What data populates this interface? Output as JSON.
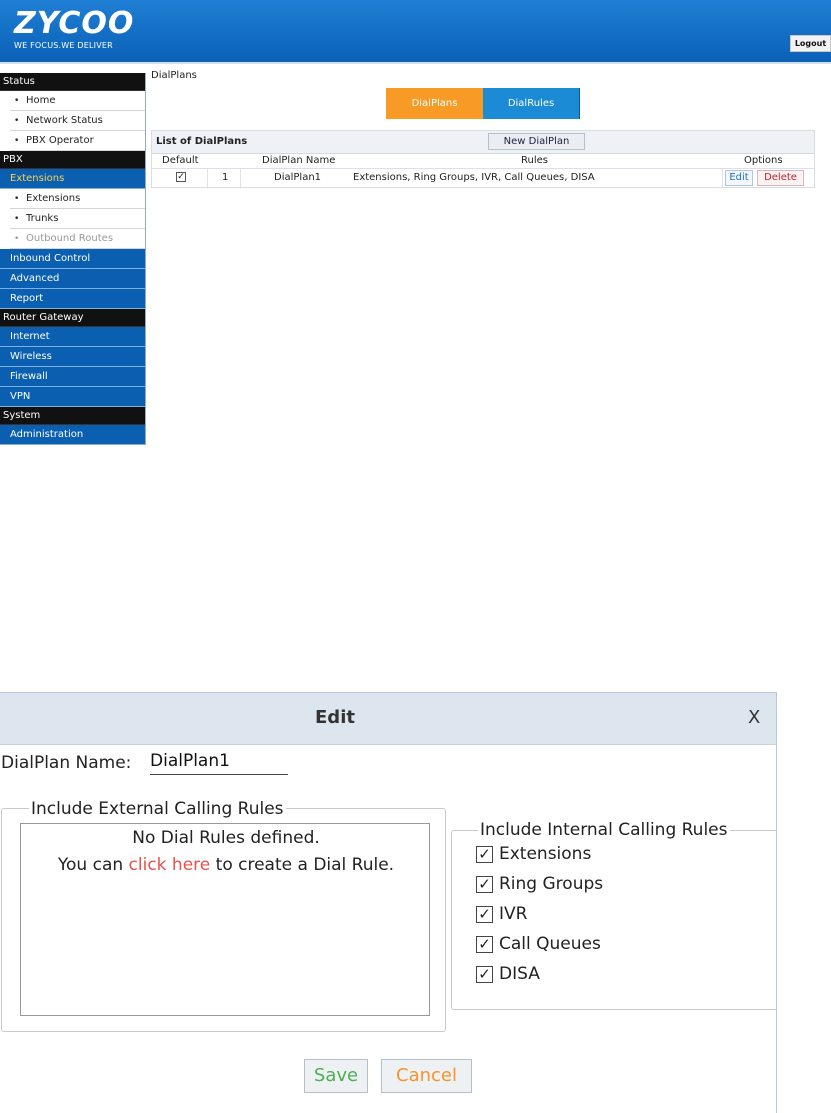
{
  "header": {
    "logo": "ZYCOO",
    "tagline": "WE FOCUS.WE DELIVER",
    "logout_label": "Logout"
  },
  "sidebar": {
    "status_label": "Status",
    "status_items": [
      "Home",
      "Network Status",
      "PBX Operator"
    ],
    "pbx_label": "PBX",
    "extensions_label": "Extensions",
    "pbx_items": [
      "Extensions",
      "Trunks",
      "Outbound Routes"
    ],
    "pbx_blue": [
      "Inbound Control",
      "Advanced",
      "Report"
    ],
    "router_label": "Router Gateway",
    "router_items": [
      "Internet",
      "Wireless",
      "Firewall",
      "VPN"
    ],
    "system_label": "System",
    "system_items": [
      "Administration"
    ]
  },
  "main": {
    "breadcrumb": "DialPlans",
    "tabs": [
      "DialPlans",
      "DialRules"
    ],
    "list_title": "List of DialPlans",
    "new_button": "New DialPlan",
    "columns": [
      "Default",
      "DialPlan Name",
      "Rules",
      "Options"
    ],
    "rows": [
      {
        "default_check": "✓",
        "index": "1",
        "name": "DialPlan1",
        "rules": "Extensions, Ring Groups, IVR, Call Queues, DISA",
        "edit": "Edit",
        "delete": "Delete"
      }
    ]
  },
  "dialog": {
    "title": "Edit",
    "close": "X",
    "name_label": "DialPlan Name:",
    "name_value": "DialPlan1",
    "external_legend": "Include External Calling Rules",
    "no_rules_text": "No Dial Rules defined.",
    "create_prefix": "You can ",
    "create_link": "click here",
    "create_suffix": " to create a Dial Rule.",
    "internal_legend": "Include Internal Calling Rules",
    "internal_rules": [
      {
        "label": "Extensions",
        "check": "✓"
      },
      {
        "label": "Ring Groups",
        "check": "✓"
      },
      {
        "label": "IVR",
        "check": "✓"
      },
      {
        "label": "Call Queues",
        "check": "✓"
      },
      {
        "label": "DISA",
        "check": "✓"
      }
    ],
    "save_label": "Save",
    "cancel_label": "Cancel"
  },
  "colors": {
    "header_blue": "#0a61b6",
    "tab_orange": "#f79a26",
    "tab_blue": "#1a8bd4",
    "link_red": "#e8504a",
    "save_green": "#4caf50",
    "cancel_orange": "#f2952a"
  }
}
